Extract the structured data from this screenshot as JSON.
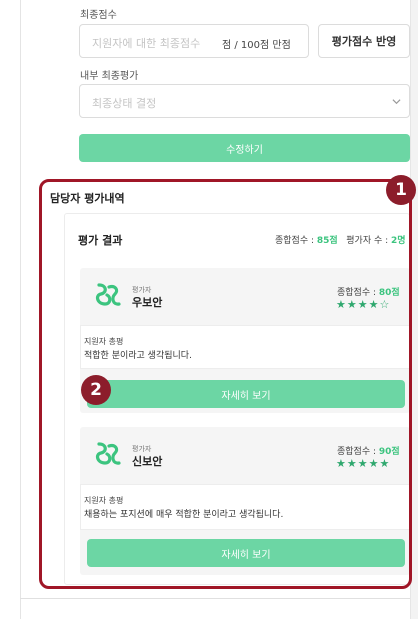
{
  "form": {
    "final_score_label": "최종점수",
    "final_score_placeholder": "지원자에 대한 최종점수",
    "final_score_suffix": "점 / 100점 만점",
    "apply_button": "평가점수 반영",
    "internal_eval_label": "내부 최종평가",
    "internal_eval_placeholder": "최종상태 결정",
    "submit_button": "수정하기"
  },
  "history": {
    "title": "담당자 평가내역",
    "result_title": "평가 결과",
    "total_label": "종합점수 : ",
    "total_value": "85점",
    "evaluator_count_label": "평가자 수 : ",
    "evaluator_count_value": "2명",
    "cards": [
      {
        "evaluator_label": "평가자",
        "name": "우보안",
        "score_label": "종합점수 : ",
        "score_value": "80점",
        "stars": "★★★★☆",
        "review_label": "지원자 총평",
        "review": "적합한 분이라고 생각됩니다.",
        "detail_button": "자세히 보기"
      },
      {
        "evaluator_label": "평가자",
        "name": "신보안",
        "score_label": "종합점수 : ",
        "score_value": "90점",
        "stars": "★★★★★",
        "review_label": "지원자 총평",
        "review": "채용하는 포지션에 매우 적합한 분이라고 생각됩니다.",
        "detail_button": "자세히 보기"
      }
    ]
  },
  "annotations": {
    "badge_1": "1",
    "badge_2": "2"
  },
  "colors": {
    "accent_green": "#6cd6a4",
    "score_green": "#3cc47f",
    "annotation_red": "#a01627"
  },
  "icons": {
    "logo": "evaluator-logo-icon",
    "select_arrow": "chevron-down-icon"
  }
}
